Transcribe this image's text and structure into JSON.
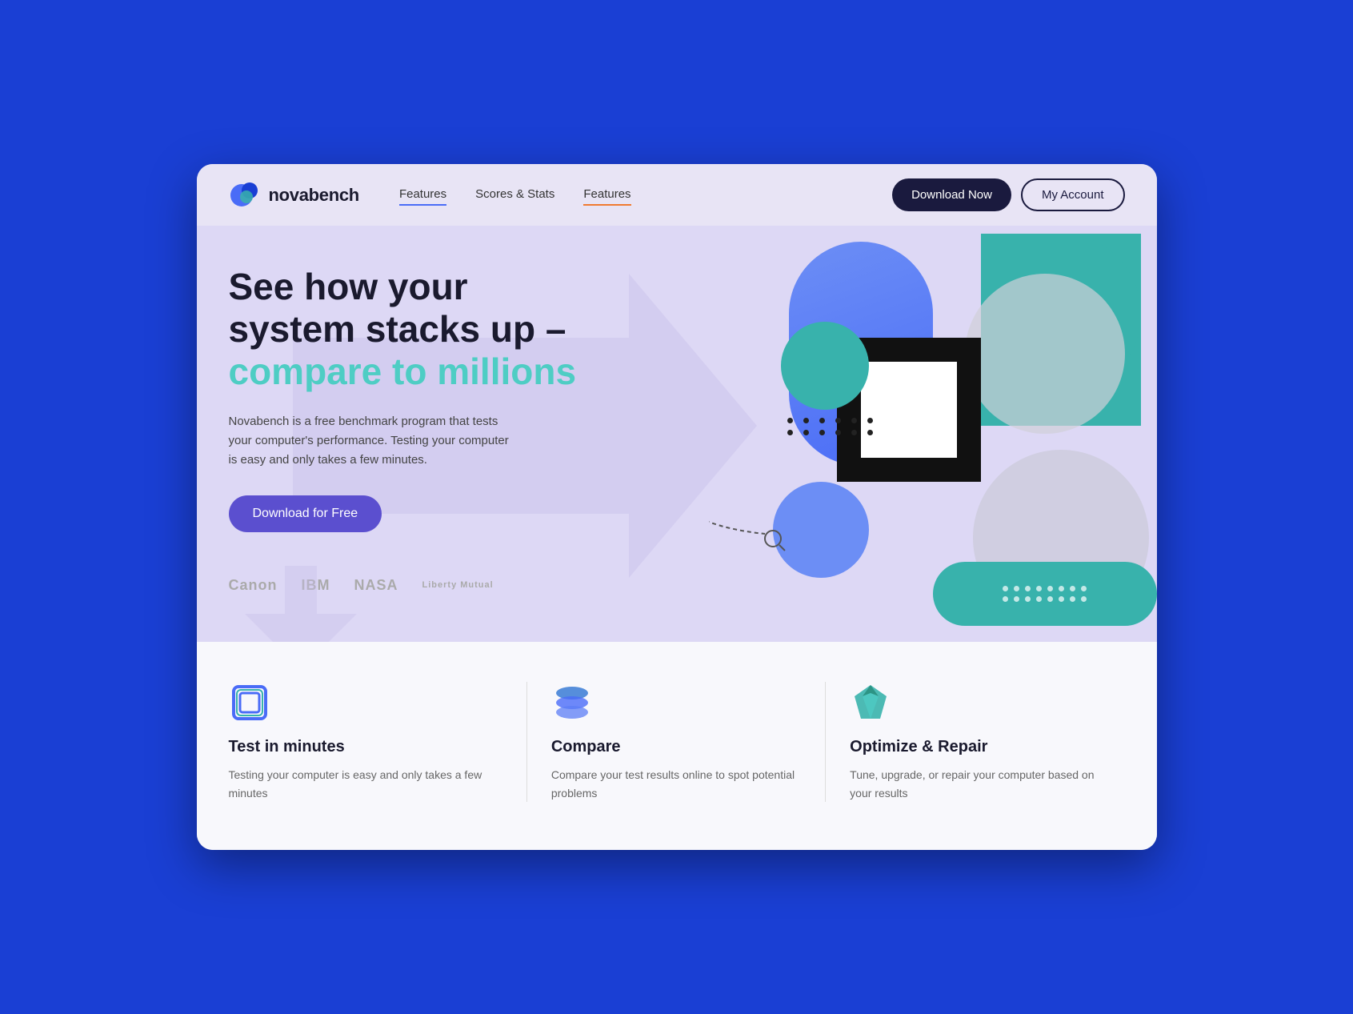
{
  "nav": {
    "logo_text": "novabench",
    "links": [
      {
        "label": "Features",
        "active": "blue"
      },
      {
        "label": "Scores & Stats",
        "active": "none"
      },
      {
        "label": "Features",
        "active": "orange"
      }
    ],
    "download_now": "Download Now",
    "my_account": "My Account"
  },
  "hero": {
    "title_line1": "See how your",
    "title_line2": "system stacks up –",
    "title_highlight": "compare to millions",
    "description": "Novabench is a free benchmark program that tests your computer's performance. Testing your computer is easy and only takes a few minutes.",
    "cta_label": "Download for Free",
    "logos": [
      "Canon",
      "IBM",
      "NASA",
      "Liberty Mutual"
    ]
  },
  "features": [
    {
      "id": "test",
      "title": "Test in minutes",
      "description": "Testing your computer is easy and only takes a few minutes"
    },
    {
      "id": "compare",
      "title": "Compare",
      "description": "Compare your test results online to spot potential problems"
    },
    {
      "id": "optimize",
      "title": "Optimize & Repair",
      "description": "Tune, upgrade, or repair your computer based on your results"
    }
  ]
}
